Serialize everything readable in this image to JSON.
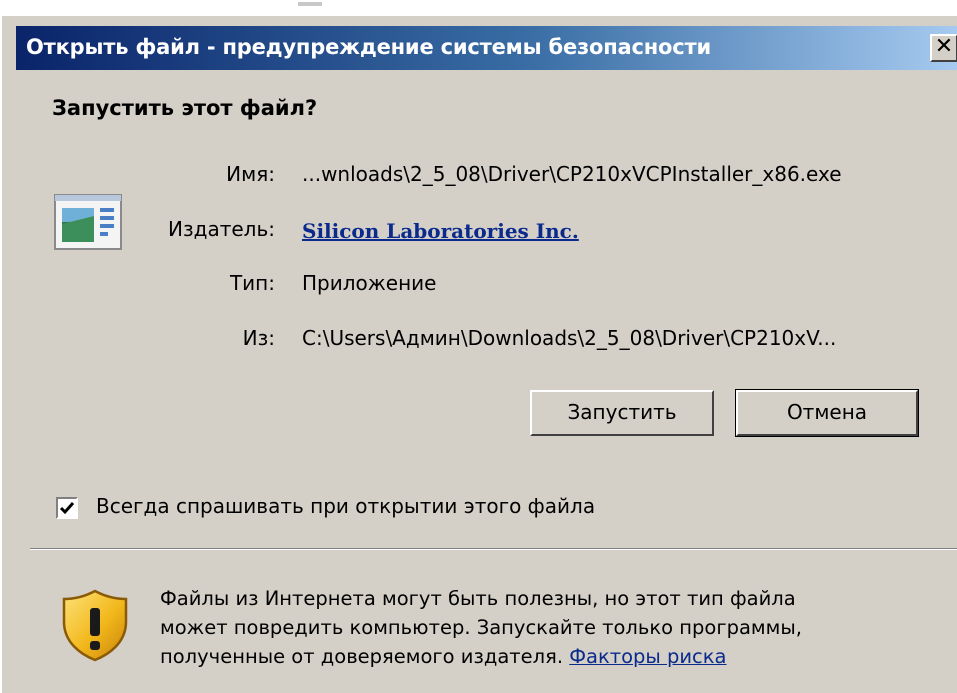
{
  "window": {
    "title": "Открыть файл - предупреждение системы безопасности",
    "close_glyph": "✕"
  },
  "question": "Запустить этот файл?",
  "details": {
    "name_label": "Имя:",
    "name_value": "...wnloads\\2_5_08\\Driver\\CP210xVCPInstaller_x86.exe",
    "publisher_label": "Издатель:",
    "publisher_value": "Silicon Laboratories Inc.",
    "type_label": "Тип:",
    "type_value": "Приложение",
    "from_label": "Из:",
    "from_value": "C:\\Users\\Админ\\Downloads\\2_5_08\\Driver\\CP210xV..."
  },
  "buttons": {
    "run_label": "Запустить",
    "cancel_label": "Отмена"
  },
  "checkbox": {
    "label": "Всегда спрашивать при открытии этого файла",
    "checked": true
  },
  "warning": {
    "line1": "Файлы из Интернета могут быть полезны, но этот тип файла",
    "line2": "может повредить компьютер. Запускайте только программы,",
    "line3": "полученные от доверяемого издателя. ",
    "risk_link": "Факторы риска"
  },
  "colors": {
    "title_gradient_start": "#0a246a",
    "title_gradient_end": "#a6caf0",
    "dialog_face": "#d4d0c8",
    "link": "#0a2a8c",
    "shield": "#f2b81c"
  },
  "icons": {
    "file": "application-file-icon",
    "shield": "security-warning-shield-icon",
    "check": "checkmark-icon"
  }
}
